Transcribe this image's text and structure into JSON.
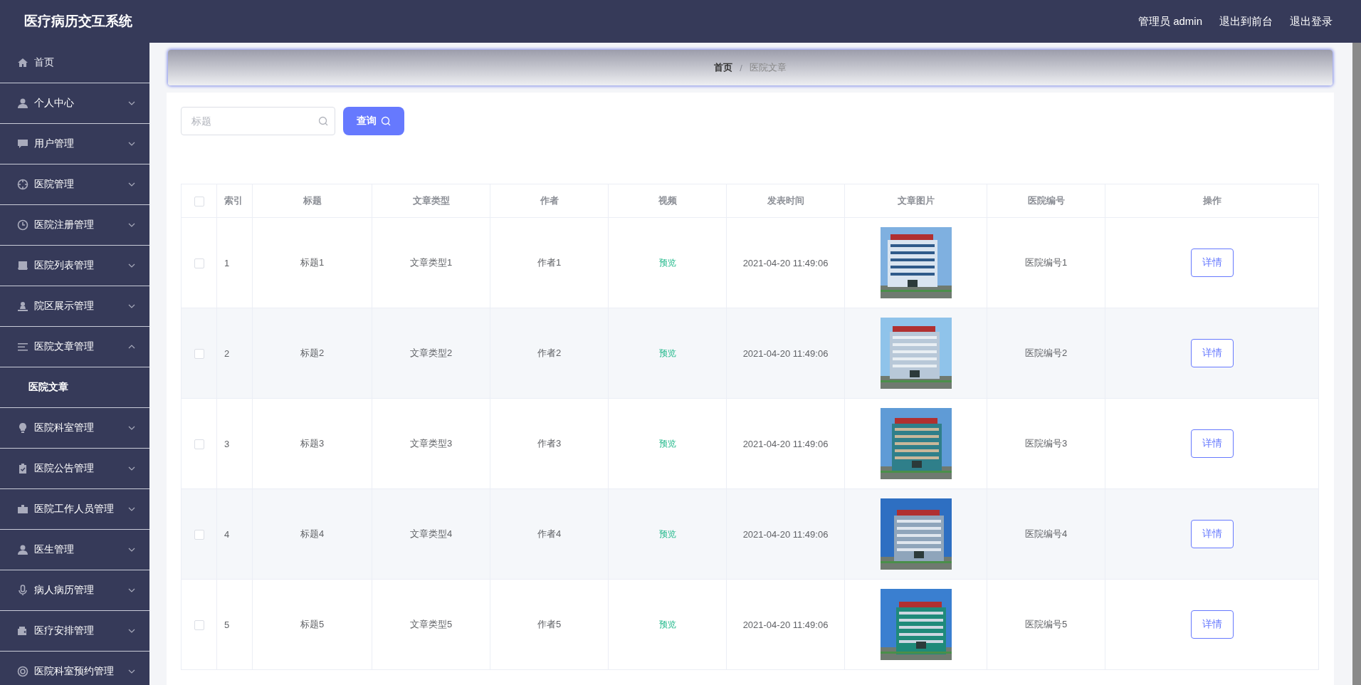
{
  "header": {
    "title": "医疗病历交互系统",
    "links": [
      "管理员 admin",
      "退出到前台",
      "退出登录"
    ]
  },
  "sidebar": {
    "items": [
      {
        "label": "首页",
        "kind": "link"
      },
      {
        "label": "个人中心",
        "kind": "menu",
        "expanded": false
      },
      {
        "label": "用户管理",
        "kind": "menu",
        "expanded": false
      },
      {
        "label": "医院管理",
        "kind": "menu",
        "expanded": false
      },
      {
        "label": "医院注册管理",
        "kind": "menu",
        "expanded": false
      },
      {
        "label": "医院列表管理",
        "kind": "menu",
        "expanded": false
      },
      {
        "label": "院区展示管理",
        "kind": "menu",
        "expanded": false
      },
      {
        "label": "医院文章管理",
        "kind": "menu",
        "expanded": true,
        "children": [
          {
            "label": "医院文章"
          }
        ]
      },
      {
        "label": "医院科室管理",
        "kind": "menu",
        "expanded": false
      },
      {
        "label": "医院公告管理",
        "kind": "menu",
        "expanded": false
      },
      {
        "label": "医院工作人员管理",
        "kind": "menu",
        "expanded": false
      },
      {
        "label": "医生管理",
        "kind": "menu",
        "expanded": false
      },
      {
        "label": "病人病历管理",
        "kind": "menu",
        "expanded": false
      },
      {
        "label": "医疗安排管理",
        "kind": "menu",
        "expanded": false
      },
      {
        "label": "医院科室预约管理",
        "kind": "menu",
        "expanded": false
      }
    ]
  },
  "breadcrumb": {
    "items": [
      "首页",
      "医院文章"
    ],
    "separator": "/"
  },
  "search": {
    "placeholder": "标题",
    "button": "查询"
  },
  "table": {
    "all_checked": false,
    "columns": [
      "索引",
      "标题",
      "文章类型",
      "作者",
      "视频",
      "发表时间",
      "文章图片",
      "医院编号",
      "操作"
    ],
    "rows": [
      {
        "checked": false,
        "index": "1",
        "title": "标题1",
        "type": "文章类型1",
        "author": "作者1",
        "video": "预览",
        "time": "2021-04-20 11:49:06",
        "hospital_no": "医院编号1",
        "action": "详情"
      },
      {
        "checked": false,
        "index": "2",
        "title": "标题2",
        "type": "文章类型2",
        "author": "作者2",
        "video": "预览",
        "time": "2021-04-20 11:49:06",
        "hospital_no": "医院编号2",
        "action": "详情"
      },
      {
        "checked": false,
        "index": "3",
        "title": "标题3",
        "type": "文章类型3",
        "author": "作者3",
        "video": "预览",
        "time": "2021-04-20 11:49:06",
        "hospital_no": "医院编号3",
        "action": "详情"
      },
      {
        "checked": false,
        "index": "4",
        "title": "标题4",
        "type": "文章类型4",
        "author": "作者4",
        "video": "预览",
        "time": "2021-04-20 11:49:06",
        "hospital_no": "医院编号4",
        "action": "详情"
      },
      {
        "checked": false,
        "index": "5",
        "title": "标题5",
        "type": "文章类型5",
        "author": "作者5",
        "video": "预览",
        "time": "2021-04-20 11:49:06",
        "hospital_no": "医院编号5",
        "action": "详情"
      }
    ]
  }
}
